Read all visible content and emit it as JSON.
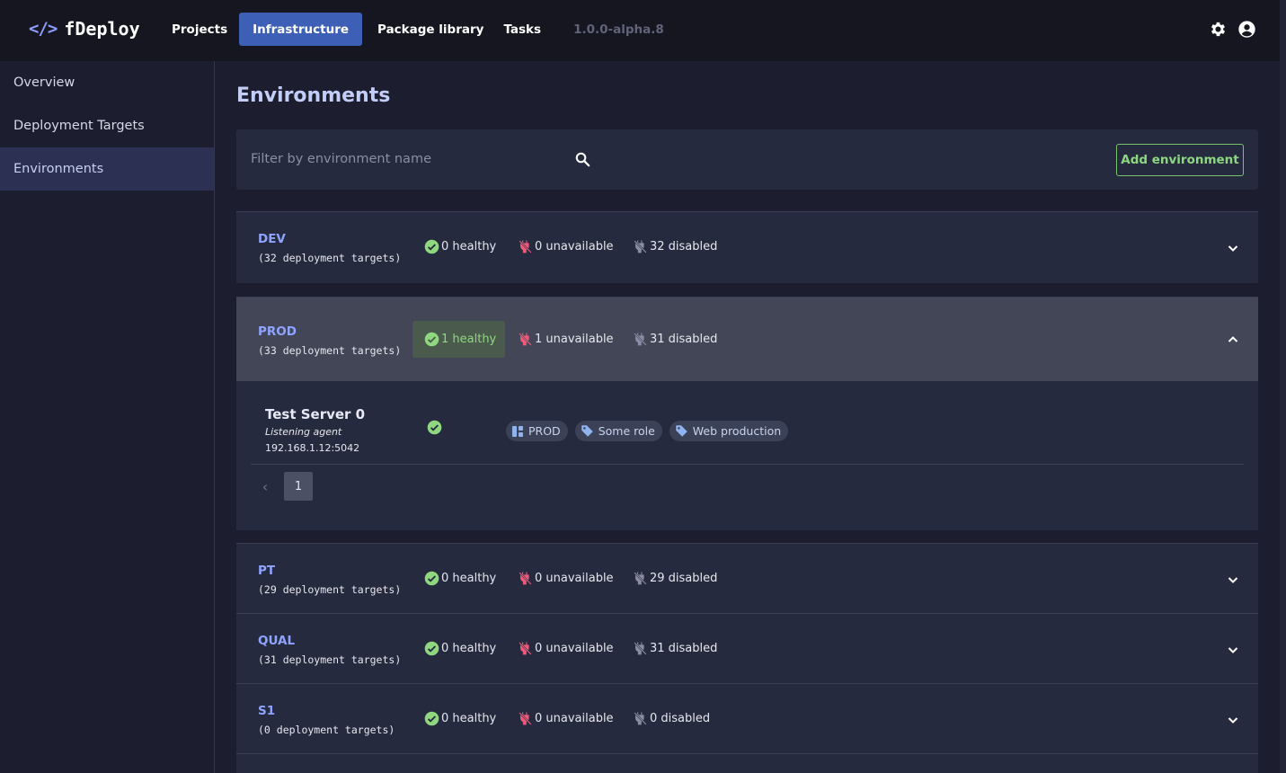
{
  "app": {
    "logo_icon": "</>",
    "name": "fDeploy",
    "version": "1.0.0-alpha.8"
  },
  "nav": {
    "items": [
      {
        "label": "Projects",
        "active": false
      },
      {
        "label": "Infrastructure",
        "active": true
      },
      {
        "label": "Package library",
        "active": false
      },
      {
        "label": "Tasks",
        "active": false
      }
    ]
  },
  "header_icons": [
    "gear-icon",
    "user-circle-icon"
  ],
  "sidebar": {
    "items": [
      {
        "label": "Overview",
        "active": false
      },
      {
        "label": "Deployment Targets",
        "active": false
      },
      {
        "label": "Environments",
        "active": true
      }
    ]
  },
  "page": {
    "title": "Environments",
    "filter_placeholder": "Filter by environment name",
    "add_button": "Add environment"
  },
  "environments": [
    {
      "name": "DEV",
      "count_text": "(32 deployment targets)",
      "healthy": "0 healthy",
      "unavailable": "0 unavailable",
      "disabled": "32 disabled",
      "expanded": false
    },
    {
      "name": "PROD",
      "count_text": "(33 deployment targets)",
      "healthy": "1 healthy",
      "unavailable": "1 unavailable",
      "disabled": "31 disabled",
      "expanded": true,
      "targets": [
        {
          "name": "Test Server 0",
          "type": "Listening agent",
          "address": "192.168.1.12:5042",
          "status": "healthy",
          "tags": [
            {
              "label": "PROD",
              "icon": "environment-icon"
            },
            {
              "label": "Some role",
              "icon": "tag-icon"
            },
            {
              "label": "Web production",
              "icon": "tag-icon"
            }
          ]
        }
      ],
      "page": "1"
    },
    {
      "name": "PT",
      "count_text": "(29 deployment targets)",
      "healthy": "0 healthy",
      "unavailable": "0 unavailable",
      "disabled": "29 disabled",
      "expanded": false
    },
    {
      "name": "QUAL",
      "count_text": "(31 deployment targets)",
      "healthy": "0 healthy",
      "unavailable": "0 unavailable",
      "disabled": "31 disabled",
      "expanded": false
    },
    {
      "name": "S1",
      "count_text": "(0 deployment targets)",
      "healthy": "0 healthy",
      "unavailable": "0 unavailable",
      "disabled": "0 disabled",
      "expanded": false
    }
  ],
  "colors": {
    "accent": "#3d5fb5",
    "healthy": "#8fd87f",
    "unavailable": "#f05a7a",
    "disabled": "#8a8da3",
    "env_name": "#8ea4ff"
  }
}
